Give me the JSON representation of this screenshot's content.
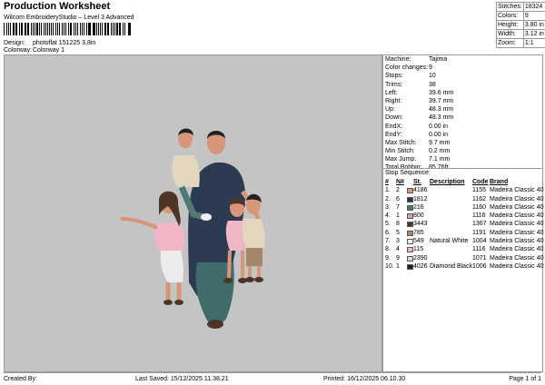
{
  "header": {
    "title": "Production Worksheet",
    "subtitle": "Wilcom EmbroideryStudio – Level 3 Advanced",
    "design_label": "Design:",
    "design_value": "photoflat 151225 3,8in",
    "colorway_label": "Colorway:",
    "colorway_value": "Colorway 1",
    "stats": [
      {
        "k": "Stitches:",
        "v": "18324"
      },
      {
        "k": "Colors:",
        "v": "9"
      },
      {
        "k": "Height:",
        "v": "3.80 in"
      },
      {
        "k": "Width:",
        "v": "3.12 in"
      },
      {
        "k": "Zoom:",
        "v": "1:1"
      }
    ]
  },
  "props": [
    {
      "k": "Machine:",
      "v": "Tajima"
    },
    {
      "k": "Color changes:",
      "v": "9"
    },
    {
      "k": "Stops:",
      "v": "10"
    },
    {
      "k": "Trims:",
      "v": "38"
    },
    {
      "k": "Left:",
      "v": "39.6 mm"
    },
    {
      "k": "Right:",
      "v": "39.7 mm"
    },
    {
      "k": "Up:",
      "v": "48.3 mm"
    },
    {
      "k": "Down:",
      "v": "48.3 mm"
    },
    {
      "k": "EndX:",
      "v": "0.00 in"
    },
    {
      "k": "EndY:",
      "v": "0.00 in"
    },
    {
      "k": "Max Stitch:",
      "v": "9.7 mm"
    },
    {
      "k": "Min Stitch:",
      "v": "0.2 mm"
    },
    {
      "k": "Max Jump:",
      "v": "7.1 mm"
    },
    {
      "k": "Total Bobbin:",
      "v": "85.76ft"
    }
  ],
  "stop_sequence": {
    "title": "Stop Sequence:",
    "headers": {
      "n": "#",
      "nn": "N#",
      "st": "St.",
      "desc": "Description",
      "code": "Code",
      "brand": "Brand"
    },
    "rows": [
      {
        "n": "1.",
        "nn": "2",
        "color": "#d8957a",
        "st": "4186",
        "desc": "",
        "code": "1155",
        "brand": "Madeira Classic 40"
      },
      {
        "n": "2.",
        "nn": "6",
        "color": "#28384f",
        "st": "1812",
        "desc": "",
        "code": "1162",
        "brand": "Madeira Classic 40"
      },
      {
        "n": "3.",
        "nn": "7",
        "color": "#4e7a76",
        "st": "216",
        "desc": "",
        "code": "1160",
        "brand": "Madeira Classic 40"
      },
      {
        "n": "4.",
        "nn": "1",
        "color": "#e59fb2",
        "st": "800",
        "desc": "",
        "code": "1116",
        "brand": "Madeira Classic 40"
      },
      {
        "n": "5.",
        "nn": "8",
        "color": "#4a3526",
        "st": "3443",
        "desc": "",
        "code": "1367",
        "brand": "Madeira Classic 40"
      },
      {
        "n": "6.",
        "nn": "5",
        "color": "#a6866a",
        "st": "785",
        "desc": "",
        "code": "1191",
        "brand": "Madeira Classic 40"
      },
      {
        "n": "7.",
        "nn": "3",
        "color": "#ececec",
        "st": "549",
        "desc": "Natural White",
        "code": "1004",
        "brand": "Madeira Classic 40"
      },
      {
        "n": "8.",
        "nn": "4",
        "color": "#f1b6c6",
        "st": "115",
        "desc": "",
        "code": "1116",
        "brand": "Madeira Classic 40"
      },
      {
        "n": "9.",
        "nn": "9",
        "color": "#e3d7c0",
        "st": "2390",
        "desc": "",
        "code": "1071",
        "brand": "Madeira Classic 40"
      },
      {
        "n": "10.",
        "nn": "1",
        "color": "#222222",
        "st": "4026",
        "desc": "Diamond Black",
        "code": "1006",
        "brand": "Madeira Classic 40"
      }
    ]
  },
  "footer": {
    "created_by": "Created By:",
    "last_saved": "Last Saved: 15/12/2025 11.38.21",
    "printed": "Printed: 16/12/2025 06.10.30",
    "page": "Page 1 of 1"
  }
}
